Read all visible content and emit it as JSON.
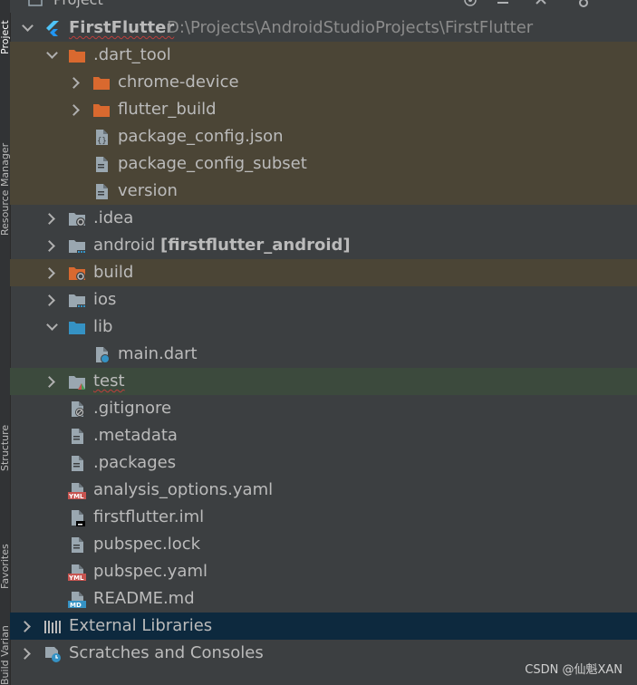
{
  "window": {
    "panel_title": "Project",
    "stripe_labels": [
      "Project",
      "Resource Manager",
      "Structure",
      "Favorites",
      "Build Variants"
    ]
  },
  "colors": {
    "folder_orange": "#d9692f",
    "folder_gray": "#9aa7b0",
    "folder_blue": "#3592c4",
    "text": "#bbbbbb",
    "path_text": "#8c8c8c",
    "highlight_brown": "#4b4536",
    "highlight_green": "#3c4a3d",
    "highlight_blue": "#0d293e"
  },
  "tree": [
    {
      "id": "firstflutter",
      "level": 0,
      "expanded": true,
      "label": "FirstFlutter",
      "bold": true,
      "path": "D:\\Projects\\AndroidStudioProjects\\FirstFlutter",
      "icon": "flutter-icon"
    },
    {
      "id": "dart-tool",
      "level": 1,
      "expanded": true,
      "label": ".dart_tool",
      "icon": "folder-orange-icon",
      "hl": "brown"
    },
    {
      "id": "chrome-device",
      "level": 2,
      "expanded": false,
      "label": "chrome-device",
      "icon": "folder-orange-icon",
      "hl": "brown"
    },
    {
      "id": "flutter-build",
      "level": 2,
      "expanded": false,
      "label": "flutter_build",
      "icon": "folder-orange-icon",
      "hl": "brown"
    },
    {
      "id": "package-config-json",
      "level": 2,
      "label": "package_config.json",
      "icon": "json-file-icon",
      "hl": "brown"
    },
    {
      "id": "package-config-subset",
      "level": 2,
      "label": "package_config_subset",
      "icon": "text-file-icon",
      "hl": "brown"
    },
    {
      "id": "version",
      "level": 2,
      "label": "version",
      "icon": "text-file-icon",
      "hl": "brown"
    },
    {
      "id": "idea",
      "level": 1,
      "expanded": false,
      "label": ".idea",
      "icon": "folder-gear-icon"
    },
    {
      "id": "android",
      "level": 1,
      "expanded": false,
      "label": "android",
      "module": "[firstflutter_android]",
      "icon": "folder-module-icon"
    },
    {
      "id": "build",
      "level": 1,
      "expanded": false,
      "label": "build",
      "icon": "folder-gear-orange-icon",
      "hl": "brown"
    },
    {
      "id": "ios",
      "level": 1,
      "expanded": false,
      "label": "ios",
      "icon": "folder-module-icon"
    },
    {
      "id": "lib",
      "level": 1,
      "expanded": true,
      "label": "lib",
      "icon": "folder-blue-icon"
    },
    {
      "id": "main-dart",
      "level": 2,
      "label": "main.dart",
      "icon": "dart-file-icon"
    },
    {
      "id": "test",
      "level": 1,
      "expanded": false,
      "label": "test",
      "icon": "folder-test-icon",
      "hl": "green",
      "squiggle": true
    },
    {
      "id": "gitignore",
      "level": 1,
      "label": ".gitignore",
      "icon": "gitignore-file-icon"
    },
    {
      "id": "metadata",
      "level": 1,
      "label": ".metadata",
      "icon": "text-file-icon"
    },
    {
      "id": "packages",
      "level": 1,
      "label": ".packages",
      "icon": "text-file-icon"
    },
    {
      "id": "analysis-options",
      "level": 1,
      "label": "analysis_options.yaml",
      "icon": "yaml-file-icon"
    },
    {
      "id": "firstflutter-iml",
      "level": 1,
      "label": "firstflutter.iml",
      "icon": "iml-file-icon"
    },
    {
      "id": "pubspec-lock",
      "level": 1,
      "label": "pubspec.lock",
      "icon": "text-file-icon"
    },
    {
      "id": "pubspec-yaml",
      "level": 1,
      "label": "pubspec.yaml",
      "icon": "yaml-file-icon"
    },
    {
      "id": "readme",
      "level": 1,
      "label": "README.md",
      "icon": "md-file-icon"
    },
    {
      "id": "external-libraries",
      "level": 0,
      "expanded": false,
      "label": "External Libraries",
      "icon": "library-icon",
      "hl": "blue"
    },
    {
      "id": "scratches",
      "level": 0,
      "expanded": false,
      "label": "Scratches and Consoles",
      "icon": "scratches-icon"
    }
  ],
  "watermark": "CSDN @仙魁XAN"
}
